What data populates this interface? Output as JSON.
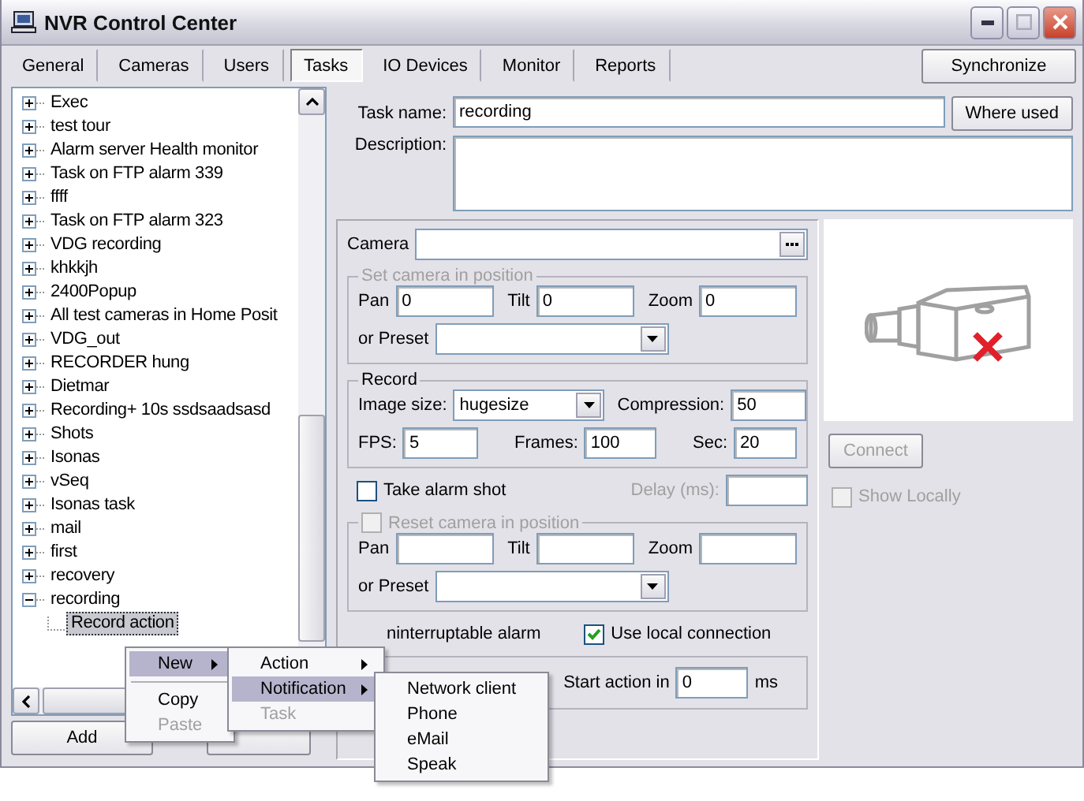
{
  "window": {
    "title": "NVR Control Center"
  },
  "tabs": [
    {
      "label": "General",
      "selected": false
    },
    {
      "label": "Cameras",
      "selected": false
    },
    {
      "label": "Users",
      "selected": false
    },
    {
      "label": "Tasks",
      "selected": true
    },
    {
      "label": "IO Devices",
      "selected": false
    },
    {
      "label": "Monitor",
      "selected": false
    },
    {
      "label": "Reports",
      "selected": false
    }
  ],
  "synchronize_button": "Synchronize",
  "tree": {
    "items": [
      {
        "label": "Exec",
        "expanded": false,
        "selected": false
      },
      {
        "label": "test tour",
        "expanded": false,
        "selected": false
      },
      {
        "label": "Alarm server Health monitor",
        "expanded": false,
        "selected": false
      },
      {
        "label": "Task on FTP alarm 339",
        "expanded": false,
        "selected": false
      },
      {
        "label": "ffff",
        "expanded": false,
        "selected": false
      },
      {
        "label": "Task on FTP alarm 323",
        "expanded": false,
        "selected": false
      },
      {
        "label": "VDG recording",
        "expanded": false,
        "selected": false
      },
      {
        "label": "khkkjh",
        "expanded": false,
        "selected": false
      },
      {
        "label": "2400Popup",
        "expanded": false,
        "selected": false
      },
      {
        "label": "All test cameras in Home Posit",
        "expanded": false,
        "selected": false
      },
      {
        "label": "VDG_out",
        "expanded": false,
        "selected": false
      },
      {
        "label": "RECORDER hung",
        "expanded": false,
        "selected": false
      },
      {
        "label": "Dietmar",
        "expanded": false,
        "selected": false
      },
      {
        "label": "Recording+ 10s ssdsaadsasd",
        "expanded": false,
        "selected": false
      },
      {
        "label": "Shots",
        "expanded": false,
        "selected": false
      },
      {
        "label": "Isonas",
        "expanded": false,
        "selected": false
      },
      {
        "label": "vSeq",
        "expanded": false,
        "selected": false
      },
      {
        "label": "Isonas task",
        "expanded": false,
        "selected": false
      },
      {
        "label": "mail",
        "expanded": false,
        "selected": false
      },
      {
        "label": "first",
        "expanded": false,
        "selected": false
      },
      {
        "label": "recovery",
        "expanded": false,
        "selected": false
      },
      {
        "label": "recording",
        "expanded": true,
        "selected": false,
        "children": [
          {
            "label": "Record action",
            "selected": true
          }
        ]
      }
    ]
  },
  "add_button": "Add",
  "task": {
    "name_label": "Task name:",
    "name": "recording",
    "where_used_button": "Where used",
    "description_label": "Description:"
  },
  "camera": {
    "label": "Camera"
  },
  "set_position": {
    "title": "Set camera in position",
    "disabled": true,
    "pan_label": "Pan",
    "pan": "0",
    "tilt_label": "Tilt",
    "tilt": "0",
    "zoom_label": "Zoom",
    "zoom": "0",
    "preset_label": "or Preset"
  },
  "record": {
    "title": "Record",
    "image_size_label": "Image size:",
    "image_size": "hugesize",
    "compression_label": "Compression:",
    "compression": "50",
    "fps_label": "FPS:",
    "fps": "5",
    "frames_label": "Frames:",
    "frames": "100",
    "sec_label": "Sec:",
    "sec": "20"
  },
  "alarm_shot": {
    "label": "Take alarm shot",
    "checked": false,
    "delay_label": "Delay (ms):",
    "delay_disabled": true
  },
  "reset_position": {
    "title": "Reset camera in position",
    "checked": false,
    "disabled": true,
    "pan_label": "Pan",
    "tilt_label": "Tilt",
    "zoom_label": "Zoom",
    "preset_label": "or Preset"
  },
  "uninterruptable": {
    "label": "ninterruptable alarm"
  },
  "use_local": {
    "label": "Use local connection",
    "checked": true
  },
  "start_action": {
    "label": "Start action in",
    "value": "0",
    "unit": "ms"
  },
  "preview": {
    "connect_button": "Connect",
    "connect_disabled": true,
    "show_locally": {
      "label": "Show Locally",
      "checked": false,
      "disabled": true
    }
  },
  "context_menu": {
    "items": [
      {
        "kind": "submenu",
        "label": "New",
        "selected": true,
        "disabled": false
      },
      {
        "kind": "separator"
      },
      {
        "kind": "item",
        "label": "Copy",
        "selected": false,
        "disabled": false
      },
      {
        "kind": "item",
        "label": "Paste",
        "selected": false,
        "disabled": true
      }
    ]
  },
  "submenu": {
    "items": [
      {
        "kind": "submenu",
        "label": "Action",
        "selected": false,
        "disabled": false
      },
      {
        "kind": "submenu",
        "label": "Notification",
        "selected": true,
        "disabled": false
      },
      {
        "kind": "item",
        "label": "Task",
        "selected": false,
        "disabled": true
      }
    ]
  },
  "notification_menu": {
    "items": [
      {
        "kind": "item",
        "label": "Network client",
        "selected": false,
        "disabled": false
      },
      {
        "kind": "item",
        "label": "Phone",
        "selected": false,
        "disabled": false
      },
      {
        "kind": "item",
        "label": "eMail",
        "selected": false,
        "disabled": false
      },
      {
        "kind": "item",
        "label": "Speak",
        "selected": false,
        "disabled": false
      }
    ]
  }
}
